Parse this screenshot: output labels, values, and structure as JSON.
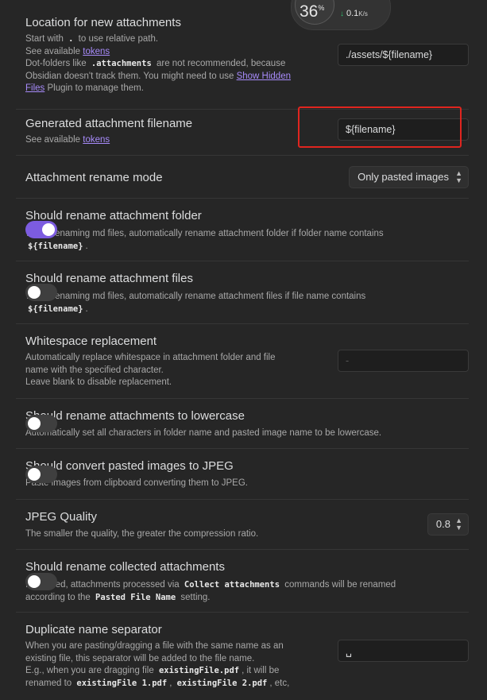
{
  "widget": {
    "percent": "36",
    "percent_unit": "%",
    "speed_value": "0.1",
    "speed_unit": "K/s"
  },
  "settings": {
    "location": {
      "name": "Location for new attachments",
      "desc_line1_pre": "Start with",
      "desc_line1_code": ".",
      "desc_line1_post": "to use relative path.",
      "desc_line2_pre": "See available",
      "tokens_link": "tokens",
      "desc_line3_pre": "Dot-folders like",
      "desc_line3_code": ".attachments",
      "desc_line3_post": "are not recommended, because",
      "desc_line4_pre": "Obsidian doesn't track them. You might need to use",
      "show_hidden_link": "Show Hidden",
      "desc_line5_link": "Files",
      "desc_line5_post": "Plugin to manage them.",
      "value": "./assets/${filename}"
    },
    "generated_filename": {
      "name": "Generated attachment filename",
      "desc_pre": "See available",
      "tokens_link": "tokens",
      "value": "${filename}"
    },
    "rename_mode": {
      "name": "Attachment rename mode",
      "value": "Only pasted images"
    },
    "rename_folder": {
      "name": "Should rename attachment folder",
      "desc": "When renaming md files, automatically rename attachment folder if folder name contains",
      "code": "${filename}",
      "suffix": ".",
      "enabled": true
    },
    "rename_files": {
      "name": "Should rename attachment files",
      "desc": "When renaming md files, automatically rename attachment files if file name contains",
      "code": "${filename}",
      "suffix": ".",
      "enabled": false
    },
    "whitespace": {
      "name": "Whitespace replacement",
      "desc_line1": "Automatically replace whitespace in attachment folder and file",
      "desc_line2": "name with the specified character.",
      "desc_line3": "Leave blank to disable replacement.",
      "placeholder": "-"
    },
    "lowercase": {
      "name": "Should rename attachments to lowercase",
      "desc": "Automatically set all characters in folder name and pasted image name to be lowercase.",
      "enabled": false
    },
    "jpeg": {
      "name": "Should convert pasted images to JPEG",
      "desc": "Paste images from clipboard converting them to JPEG.",
      "enabled": false
    },
    "jpeg_quality": {
      "name": "JPEG Quality",
      "desc": "The smaller the quality, the greater the compression ratio.",
      "value": "0.8"
    },
    "collected": {
      "name": "Should rename collected attachments",
      "desc_pre": "If enabled, attachments processed via",
      "code1": "Collect attachments",
      "desc_mid": "commands will be renamed",
      "desc_line2_pre": "according to the",
      "code2": "Pasted File Name",
      "desc_line2_post": "setting.",
      "enabled": false
    },
    "duplicate_separator": {
      "name": "Duplicate name separator",
      "desc_line1": "When you are pasting/dragging a file with the same name as an",
      "desc_line2": "existing file, this separator will be added to the file name.",
      "desc_line3_pre": "E.g., when you are dragging file",
      "code1": "existingFile.pdf",
      "desc_line3_post": ", it will be",
      "desc_line4_pre": "renamed to",
      "code2": "existingFile 1.pdf",
      "code3": "existingFile 2.pdf",
      "desc_line4_post": ", etc,",
      "value": "␣"
    }
  }
}
